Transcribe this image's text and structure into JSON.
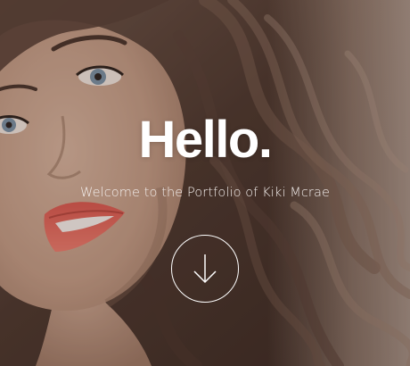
{
  "hero": {
    "title": "Hello.",
    "subtitle": "Welcome to the Portfolio of Kiki Mcrae",
    "scroll_icon": "arrow-down-icon"
  },
  "colors": {
    "text": "#ffffff",
    "skin": "#c89e88",
    "hair": "#4a342b",
    "lips": "#e0655a"
  }
}
